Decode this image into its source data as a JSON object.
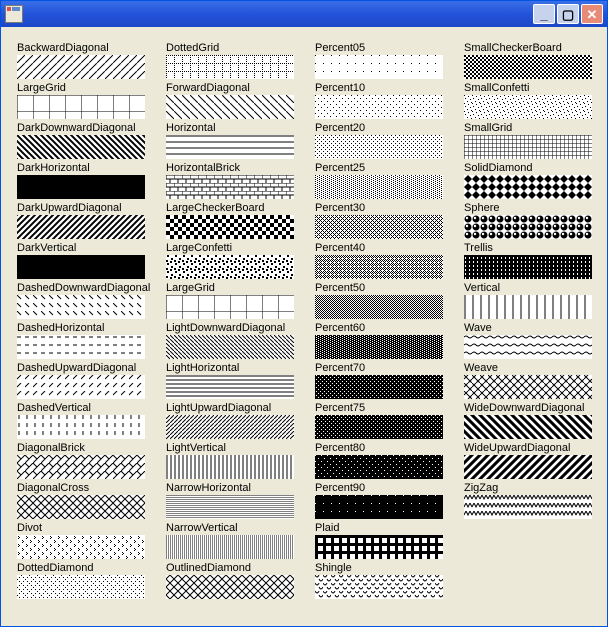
{
  "fg": "#000000",
  "bg": "#ffffff",
  "styles": [
    {
      "name": "BackwardDiagonal",
      "tile": 8,
      "paths": [
        "M0 8L8 0"
      ],
      "sw": 1
    },
    {
      "name": "LargeGrid",
      "tile": 16,
      "paths": [
        "M0 0H16",
        "M0 0V16"
      ],
      "sw": 1
    },
    {
      "name": "DarkDownwardDiagonal",
      "tile": 6,
      "paths": [
        "M0 0L6 6",
        "M-3 3L3 9",
        "M3 -3L9 3"
      ],
      "sw": 2
    },
    {
      "name": "DarkHorizontal",
      "tile": 6,
      "paths": [
        "M0 1H6",
        "M0 3H6",
        "M0 5H6"
      ],
      "sw": 2
    },
    {
      "name": "DarkUpwardDiagonal",
      "tile": 6,
      "paths": [
        "M0 6L6 0",
        "M-3 3L3 -3",
        "M3 9L9 3"
      ],
      "sw": 2
    },
    {
      "name": "DarkVertical",
      "tile": 6,
      "paths": [
        "M1 0V6",
        "M3 0V6",
        "M5 0V6"
      ],
      "sw": 2
    },
    {
      "name": "DashedDownwardDiagonal",
      "tile": 8,
      "paths": [
        "M0 0L4 4"
      ],
      "sw": 1
    },
    {
      "name": "DashedHorizontal",
      "tile": 8,
      "paths": [
        "M0 2H4"
      ],
      "sw": 1
    },
    {
      "name": "DashedUpwardDiagonal",
      "tile": 8,
      "paths": [
        "M0 4L4 0"
      ],
      "sw": 1
    },
    {
      "name": "DashedVertical",
      "tile": 8,
      "paths": [
        "M2 0V4"
      ],
      "sw": 1
    },
    {
      "name": "DiagonalBrick",
      "tile": 8,
      "paths": [
        "M0 8L8 0",
        "M0 0L4 4"
      ],
      "sw": 1
    },
    {
      "name": "DiagonalCross",
      "tile": 8,
      "paths": [
        "M0 0L8 8",
        "M0 8L8 0"
      ],
      "sw": 1
    },
    {
      "name": "Divot",
      "tile": 8,
      "dots": [
        [
          1,
          1
        ],
        [
          2,
          2
        ],
        [
          1,
          3
        ],
        [
          5,
          5
        ],
        [
          6,
          6
        ],
        [
          5,
          7
        ]
      ]
    },
    {
      "name": "DottedDiamond",
      "tile": 8,
      "dots": [
        [
          4,
          0
        ],
        [
          2,
          2
        ],
        [
          6,
          2
        ],
        [
          0,
          4
        ],
        [
          2,
          6
        ],
        [
          6,
          6
        ]
      ]
    },
    {
      "name": "DottedGrid",
      "tile": 8,
      "dots": [
        [
          0,
          0
        ],
        [
          2,
          0
        ],
        [
          4,
          0
        ],
        [
          6,
          0
        ],
        [
          0,
          2
        ],
        [
          0,
          4
        ],
        [
          0,
          6
        ]
      ]
    },
    {
      "name": "ForwardDiagonal",
      "tile": 8,
      "paths": [
        "M0 0L8 8"
      ],
      "sw": 1
    },
    {
      "name": "Horizontal",
      "tile": 6,
      "paths": [
        "M0 1H6"
      ],
      "sw": 1
    },
    {
      "name": "HorizontalBrick",
      "tile": 8,
      "paths": [
        "M0 0H8",
        "M0 4H8",
        "M0 0V4",
        "M4 4V8"
      ],
      "sw": 1
    },
    {
      "name": "LargeCheckerBoard",
      "tile": 8,
      "rects": [
        [
          0,
          0,
          4,
          4
        ],
        [
          4,
          4,
          4,
          4
        ]
      ]
    },
    {
      "name": "LargeConfetti",
      "tile": 8,
      "rects": [
        [
          1,
          0,
          2,
          2
        ],
        [
          5,
          3,
          2,
          2
        ],
        [
          0,
          5,
          2,
          2
        ],
        [
          4,
          6,
          2,
          2
        ]
      ]
    },
    {
      "name": "LargeGrid",
      "tile": 16,
      "paths": [
        "M0 0H16",
        "M0 0V16"
      ],
      "sw": 1
    },
    {
      "name": "LightDownwardDiagonal",
      "tile": 4,
      "paths": [
        "M0 0L4 4"
      ],
      "sw": 1
    },
    {
      "name": "LightHorizontal",
      "tile": 4,
      "paths": [
        "M0 1H4"
      ],
      "sw": 1
    },
    {
      "name": "LightUpwardDiagonal",
      "tile": 4,
      "paths": [
        "M0 4L4 0"
      ],
      "sw": 1
    },
    {
      "name": "LightVertical",
      "tile": 4,
      "paths": [
        "M1 0V4"
      ],
      "sw": 1
    },
    {
      "name": "NarrowHorizontal",
      "tile": 2,
      "paths": [
        "M0 0H2"
      ],
      "sw": 1
    },
    {
      "name": "NarrowVertical",
      "tile": 2,
      "paths": [
        "M0 0V2"
      ],
      "sw": 1
    },
    {
      "name": "OutlinedDiamond",
      "tile": 8,
      "paths": [
        "M4 0L8 4L4 8L0 4Z"
      ],
      "sw": 1
    },
    {
      "name": "Percent05",
      "tile": 8,
      "dots": [
        [
          0,
          0
        ]
      ]
    },
    {
      "name": "Percent10",
      "tile": 6,
      "dots": [
        [
          0,
          0
        ],
        [
          3,
          3
        ]
      ]
    },
    {
      "name": "Percent20",
      "tile": 4,
      "dots": [
        [
          0,
          0
        ],
        [
          2,
          2
        ]
      ]
    },
    {
      "name": "Percent25",
      "tile": 4,
      "dots": [
        [
          0,
          0
        ],
        [
          2,
          1
        ],
        [
          0,
          2
        ],
        [
          2,
          3
        ]
      ]
    },
    {
      "name": "Percent30",
      "tile": 4,
      "dots": [
        [
          0,
          0
        ],
        [
          2,
          0
        ],
        [
          1,
          1
        ],
        [
          0,
          2
        ],
        [
          2,
          2
        ],
        [
          3,
          3
        ]
      ]
    },
    {
      "name": "Percent40",
      "tile": 4,
      "dots": [
        [
          0,
          0
        ],
        [
          2,
          0
        ],
        [
          1,
          1
        ],
        [
          3,
          1
        ],
        [
          0,
          2
        ],
        [
          2,
          2
        ],
        [
          1,
          3
        ]
      ]
    },
    {
      "name": "Percent50",
      "tile": 2,
      "dots": [
        [
          0,
          0
        ],
        [
          1,
          1
        ]
      ]
    },
    {
      "name": "Percent60",
      "tile": 4,
      "rects": [
        [
          0,
          0,
          4,
          4
        ]
      ],
      "invDots": [
        [
          1,
          0
        ],
        [
          3,
          1
        ],
        [
          1,
          2
        ],
        [
          3,
          3
        ]
      ]
    },
    {
      "name": "Percent70",
      "tile": 4,
      "rects": [
        [
          0,
          0,
          4,
          4
        ]
      ],
      "invDots": [
        [
          1,
          0
        ],
        [
          3,
          2
        ]
      ]
    },
    {
      "name": "Percent75",
      "tile": 4,
      "rects": [
        [
          0,
          0,
          4,
          4
        ]
      ],
      "invDots": [
        [
          0,
          0
        ],
        [
          2,
          2
        ]
      ]
    },
    {
      "name": "Percent80",
      "tile": 6,
      "rects": [
        [
          0,
          0,
          6,
          6
        ]
      ],
      "invDots": [
        [
          0,
          0
        ],
        [
          3,
          3
        ]
      ]
    },
    {
      "name": "Percent90",
      "tile": 8,
      "rects": [
        [
          0,
          0,
          8,
          8
        ]
      ],
      "invDots": [
        [
          0,
          0
        ]
      ]
    },
    {
      "name": "Plaid",
      "tile": 8,
      "paths": [
        "M0 0H8",
        "M0 2H8",
        "M0 0V8",
        "M2 0V8"
      ],
      "sw": 2
    },
    {
      "name": "Shingle",
      "tile": 8,
      "paths": [
        "M0 0Q2 4 4 0",
        "M4 4Q6 8 8 4"
      ],
      "sw": 1
    },
    {
      "name": "SmallCheckerBoard",
      "tile": 4,
      "rects": [
        [
          0,
          0,
          2,
          2
        ],
        [
          2,
          2,
          2,
          2
        ]
      ]
    },
    {
      "name": "SmallConfetti",
      "tile": 8,
      "dots": [
        [
          0,
          0
        ],
        [
          4,
          1
        ],
        [
          1,
          3
        ],
        [
          6,
          4
        ],
        [
          3,
          6
        ],
        [
          7,
          7
        ]
      ]
    },
    {
      "name": "SmallGrid",
      "tile": 4,
      "paths": [
        "M0 0H4",
        "M0 0V4"
      ],
      "sw": 1
    },
    {
      "name": "SolidDiamond",
      "tile": 8,
      "poly": "4,0 8,4 4,8 0,4"
    },
    {
      "name": "Sphere",
      "tile": 8,
      "circle": true
    },
    {
      "name": "Trellis",
      "tile": 4,
      "rects": [
        [
          0,
          0,
          4,
          2
        ],
        [
          0,
          2,
          1,
          2
        ],
        [
          2,
          2,
          2,
          2
        ]
      ]
    },
    {
      "name": "Vertical",
      "tile": 8,
      "paths": [
        "M1 0V8"
      ],
      "sw": 1
    },
    {
      "name": "Wave",
      "tile": 8,
      "paths": [
        "M0 2Q2 0 4 2T8 2"
      ],
      "sw": 1
    },
    {
      "name": "Weave",
      "tile": 8,
      "paths": [
        "M0 4L4 0",
        "M4 8L8 4",
        "M0 0L8 8"
      ],
      "sw": 1
    },
    {
      "name": "WideDownwardDiagonal",
      "tile": 8,
      "paths": [
        "M0 0L8 8",
        "M-4 4L4 12",
        "M4 -4L12 4"
      ],
      "sw": 3
    },
    {
      "name": "WideUpwardDiagonal",
      "tile": 8,
      "paths": [
        "M0 8L8 0",
        "M-4 4L4 -4",
        "M4 12L12 4"
      ],
      "sw": 3
    },
    {
      "name": "ZigZag",
      "tile": 8,
      "paths": [
        "M0 4L2 0L4 4L6 0L8 4"
      ],
      "sw": 1
    }
  ]
}
